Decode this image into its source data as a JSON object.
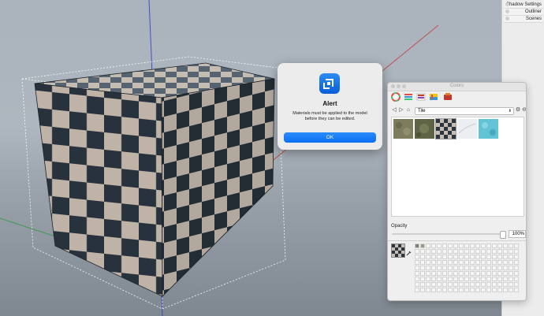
{
  "tray": {
    "items": [
      {
        "label": "Shadow Settings"
      },
      {
        "label": "Outliner"
      },
      {
        "label": "Scenes"
      }
    ]
  },
  "alert": {
    "icon": "sketchup-logo-icon",
    "title": "Alert",
    "message_line1": "Materials must be applied to the model",
    "message_line2": "before they can be edited.",
    "ok_label": "OK"
  },
  "colors_panel": {
    "title": "Colors",
    "modes": [
      "color-wheel-icon",
      "color-sliders-icon",
      "color-palettes-icon",
      "image-palettes-icon",
      "crayons-icon"
    ],
    "collection": "Tile",
    "swatches": [
      {
        "name": "tile-green-stone",
        "color": "#7d7d5e"
      },
      {
        "name": "tile-mossy-stone",
        "color": "#5f6446"
      },
      {
        "name": "tile-checker",
        "color": "#3a3f45"
      },
      {
        "name": "tile-white-marble",
        "color": "#eceff2"
      },
      {
        "name": "tile-blue-mosaic",
        "color": "#62c3d6"
      }
    ],
    "opacity_label": "Opacity",
    "opacity_value": "100%",
    "opacity": 1.0
  },
  "colors": {
    "accent": "#0a6ef3",
    "checker_dark": "#2b3640",
    "checker_light": "#b9aea3",
    "axis_red": "#c0392b",
    "axis_blue": "#2a36c9",
    "axis_green": "#2c9a3a"
  }
}
